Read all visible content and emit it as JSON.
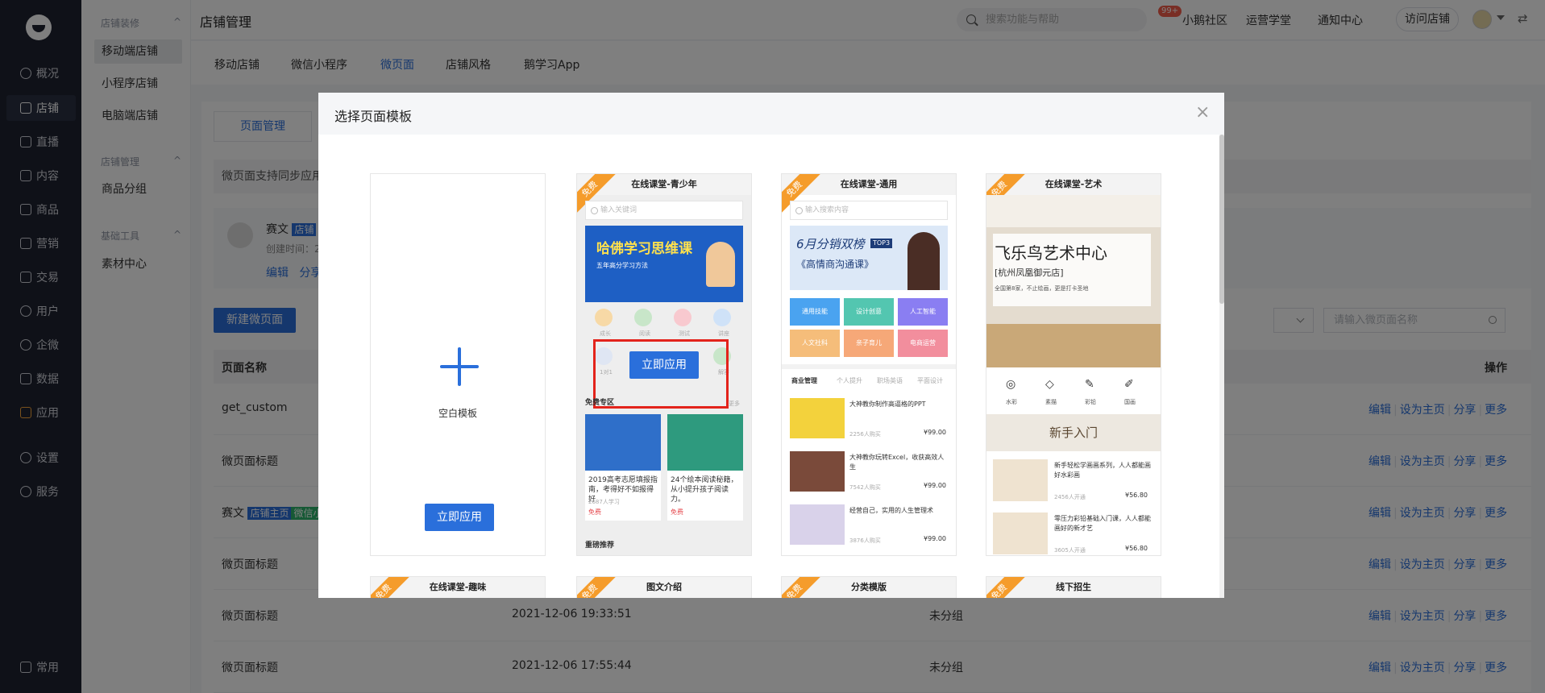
{
  "nav": {
    "items": [
      {
        "label": "概况",
        "icon": "overview-icon"
      },
      {
        "label": "店铺",
        "icon": "store-icon"
      },
      {
        "label": "直播",
        "icon": "live-icon"
      },
      {
        "label": "内容",
        "icon": "content-icon"
      },
      {
        "label": "商品",
        "icon": "goods-icon"
      },
      {
        "label": "营销",
        "icon": "marketing-icon"
      },
      {
        "label": "交易",
        "icon": "trade-icon"
      },
      {
        "label": "用户",
        "icon": "user-icon"
      },
      {
        "label": "企微",
        "icon": "wecom-icon"
      },
      {
        "label": "数据",
        "icon": "data-icon"
      },
      {
        "label": "应用",
        "icon": "apps-icon"
      },
      {
        "label": "设置",
        "icon": "settings-icon"
      },
      {
        "label": "服务",
        "icon": "service-icon"
      }
    ],
    "bottom": "常用"
  },
  "subnav": {
    "group1": "店铺装修",
    "group1_items": [
      "移动端店铺",
      "小程序店铺",
      "电脑端店铺"
    ],
    "group2": "店铺管理",
    "group2_items": [
      "商品分组"
    ],
    "group3": "基础工具",
    "group3_items": [
      "素材中心"
    ]
  },
  "topbar": {
    "title": "店铺管理",
    "search_placeholder": "搜索功能与帮助",
    "links": [
      "小鹅社区",
      "运营学堂",
      "通知中心"
    ],
    "badge": "99+",
    "visit": "访问店铺"
  },
  "page": {
    "tabs": [
      "移动店铺",
      "微信小程序",
      "微页面",
      "店铺风格",
      "鹅学习App"
    ],
    "subtab": "页面管理",
    "notice": "微页面支持同步应用",
    "shop": {
      "name": "赛文",
      "tag": "店铺",
      "created": "创建时间：2",
      "edit": "编辑",
      "share": "分享"
    },
    "new_button": "新建微页面",
    "search_placeholder": "请输入微页面名称",
    "table_headers": {
      "name": "页面名称",
      "ops": "操作"
    },
    "rows": [
      {
        "name": "get_custom",
        "time": "",
        "group": ""
      },
      {
        "name": "微页面标题",
        "time": "",
        "group": ""
      },
      {
        "name": "赛文",
        "tag1": "店铺主页",
        "tag2": "微信小",
        "time": "",
        "group": ""
      },
      {
        "name": "微页面标题",
        "time": "",
        "group": ""
      },
      {
        "name": "微页面标题",
        "time": "2021-12-06 19:33:51",
        "group": "未分组"
      },
      {
        "name": "微页面标题",
        "time": "2021-12-06 17:55:44",
        "group": "未分组"
      }
    ],
    "row_ops": [
      "编辑",
      "设为主页",
      "分享",
      "更多"
    ]
  },
  "modal": {
    "title": "选择页面模板",
    "blank_label": "空白模板",
    "apply": "立即应用",
    "free": "免费",
    "templates": [
      {
        "title": "在线课堂-青少年",
        "search": "输入关键词",
        "banner_text": "哈佛学习思维课",
        "banner_sub": "五年高分学习方法",
        "icons": [
          "成长",
          "阅读",
          "测试",
          "讲座",
          "1对1",
          "解答"
        ],
        "section": "免费专区",
        "more": "更多",
        "cards": [
          {
            "title": "2019高考志愿填报指南，考得好不如报得好",
            "learners": "2687人学习",
            "price": "免费"
          },
          {
            "title": "24个绘本阅读秘籍，从小提升孩子阅读力。",
            "learners": "",
            "price": "免费"
          }
        ],
        "footer": "重磅推荐"
      },
      {
        "title": "在线课堂-通用",
        "search": "输入搜索内容",
        "banner_text": "6月分销双榜",
        "banner_sub": "《高情商沟通课》",
        "banner_badge": "TOP3",
        "grid": [
          "通用技能",
          "设计创意",
          "人工智能",
          "人文社科",
          "亲子育儿",
          "电商运营"
        ],
        "subtabs": [
          "商业管理",
          "个人提升",
          "职场英语",
          "平面设计"
        ],
        "courses": [
          {
            "title": "大神教你制作高逼格的PPT",
            "learners": "2256人购买",
            "price": "¥99.00"
          },
          {
            "title": "大神教你玩转Excel，收获高效人生",
            "learners": "7542人购买",
            "price": "¥99.00"
          },
          {
            "title": "经营自己，实用的人生管理术",
            "learners": "3876人购买",
            "price": "¥99.00"
          }
        ]
      },
      {
        "title": "在线课堂-艺术",
        "banner_text": "飞乐鸟艺术中心",
        "banner_sub": "[杭州凤凰御元店]",
        "banner_line": "全国第8家，不止绘画，更是打卡圣地",
        "icons": [
          "水彩",
          "素描",
          "彩铅",
          "国画"
        ],
        "section": "新手入门",
        "courses": [
          {
            "title": "新手轻松学画画系列，人人都能画好水彩画",
            "learners": "2456人开通",
            "price": "¥56.80"
          },
          {
            "title": "零压力彩铅基础入门课，人人都能画好的新才艺",
            "learners": "3605人开通",
            "price": "¥56.80"
          }
        ]
      }
    ],
    "row2": [
      "在线课堂-趣味",
      "图文介绍",
      "分类模版",
      "线下招生"
    ]
  },
  "colors": {
    "primary": "#2a6fdb",
    "nav_bg": "#1f2331",
    "free_tag": "#f59c2b",
    "highlight": "#e3231b"
  }
}
